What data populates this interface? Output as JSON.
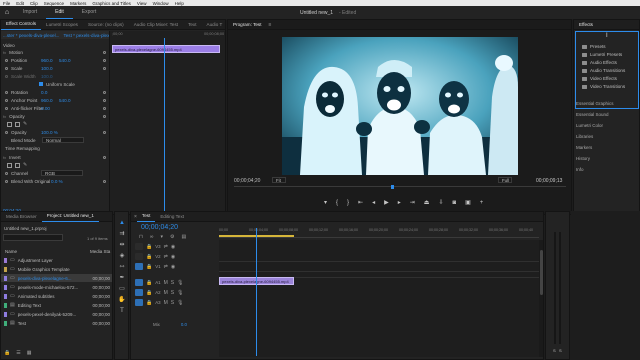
{
  "menu": [
    "File",
    "Edit",
    "Clip",
    "Sequence",
    "Markers",
    "Graphics and Titles",
    "View",
    "Window",
    "Help"
  ],
  "workspace": {
    "tabs": [
      "Import",
      "Edit",
      "Export"
    ],
    "active_tab": "Edit",
    "project_title": "Untitled new_1",
    "edited": "- Edited"
  },
  "source_panel": {
    "tabs": [
      "Effect Controls",
      "Lumetri Scopes",
      "Source: (no clips)",
      "Audio Clip Mixer: Test",
      "Text",
      "Audio T"
    ],
    "crumb_left": "...ster * pexels-diva-plexel...",
    "crumb_right": "Test * pexels-diva-plexe...",
    "ruler_start": ";00;00",
    "ruler_end": "00;00;08;00",
    "clip_label": "pexels-diva-plexelagne-6094455.mp4",
    "video_section": "Video",
    "motion": "Motion",
    "props": [
      {
        "name": "Position",
        "v1": "960.0",
        "v2": "540.0"
      },
      {
        "name": "Scale",
        "v1": "100.0",
        "v2": ""
      },
      {
        "name": "Scale Width",
        "v1": "100.0",
        "v2": ""
      }
    ],
    "uniform_scale": "Uniform Scale",
    "rotation": {
      "name": "Rotation",
      "v": "0.0"
    },
    "anchor": {
      "name": "Anchor Point",
      "v1": "960.0",
      "v2": "540.0"
    },
    "anti_flicker": {
      "name": "Anti-flicker Filter",
      "v": "0.00"
    },
    "opacity_section": "Opacity",
    "opacity": {
      "name": "Opacity",
      "v": "100.0 %"
    },
    "blend": {
      "name": "Blend Mode",
      "v": "Normal"
    },
    "time_remap": "Time Remapping",
    "invert_section": "Invert",
    "channel": {
      "name": "Channel",
      "v": "RGB"
    },
    "blend_original": {
      "name": "Blend With Original",
      "v": "0.0 %"
    },
    "timecode": "00;04;20"
  },
  "program": {
    "title": "Program: Test",
    "timecode": "00;00;04;20",
    "fit": "Fit",
    "full": "Full",
    "duration": "00;00;09;13"
  },
  "effects": {
    "title": "Effects",
    "items": [
      "Presets",
      "Lumetri Presets",
      "Audio Effects",
      "Audio Transitions",
      "Video Effects",
      "Video Transitions"
    ],
    "side_panels": [
      "Essential Graphics",
      "Essential Sound",
      "Lumetri Color",
      "Libraries",
      "Markers",
      "History",
      "Info"
    ]
  },
  "project": {
    "tabs": [
      "Media Browser",
      "Project: Untitled new_1"
    ],
    "file": "Untitled new_1.prproj",
    "count": "1 of 9 items",
    "name_header": "Name",
    "frame_header": "Media Sta",
    "items": [
      {
        "name": "Adjustment Layer",
        "dur": "",
        "color": "#9a7ad6"
      },
      {
        "name": "Mobile Graphics Template",
        "dur": "",
        "color": "#c2a34a"
      },
      {
        "name": "pexels-diva-plexelagne-6...",
        "dur": "00;00;00",
        "color": "#8f7de0",
        "selected": true
      },
      {
        "name": "pexels-mode-michaelou-572...",
        "dur": "00;00;00",
        "color": "#8f7de0"
      },
      {
        "name": "Animated subtitles",
        "dur": "00;00;00",
        "color": "#8f7de0"
      },
      {
        "name": "Editing Text",
        "dur": "00;00;00",
        "color": "#3fae7a"
      },
      {
        "name": "pexels-pexel-denilyak-5209...",
        "dur": "00;00;00",
        "color": "#8f7de0"
      },
      {
        "name": "Test",
        "dur": "00;00;00",
        "color": "#3fae7a"
      }
    ]
  },
  "timeline": {
    "tabs": [
      "Test",
      "Editing Text"
    ],
    "timecode": "00;00;04;20",
    "ruler": [
      "00;00",
      "00;00;04;00",
      "00;00;08;00",
      "00;00;12;00",
      "00;00;16;00",
      "00;00;20;00",
      "00;00;24;00",
      "00;00;28;00",
      "00;00;32;00",
      "00;00;36;00",
      "00;00;40"
    ],
    "video_tracks": [
      "V3",
      "V2",
      "V1"
    ],
    "audio_tracks": [
      "A1",
      "A2",
      "A3"
    ],
    "mix": "Mix",
    "mix_value": "0.0",
    "clip_label": "pexels-diva-plexelagne-6094455.mp4",
    "audio_meter_labels": [
      "S",
      "S"
    ]
  }
}
